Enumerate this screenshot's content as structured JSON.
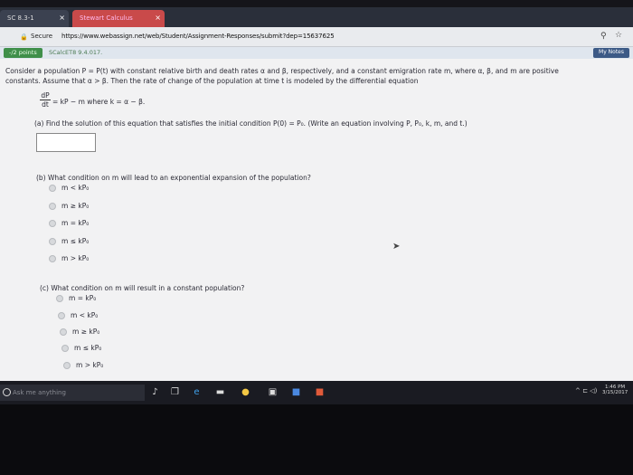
{
  "browser": {
    "tabs": [
      {
        "label": "SC 8.3-1"
      },
      {
        "label": "Stewart Calculus"
      }
    ],
    "secure_label": "Secure",
    "url": "https://www.webassign.net/web/Student/Assignment-Responses/submit?dep=15637625"
  },
  "assignment": {
    "points": "-/2 points",
    "score_info": "SCalcET8 9.4.017.",
    "my_notes": "My Notes"
  },
  "question": {
    "intro_line1": "Consider a population P = P(t) with constant relative birth and death rates α and β, respectively, and a constant emigration rate m, where α, β, and m are positive",
    "intro_line2": "constants. Assume that α > β. Then the rate of change of the population at time t is modeled by the differential equation",
    "eq_num": "dP",
    "eq_den": "dt",
    "eq_rest": "= kP − m   where  k = α − β.",
    "part_a": "(a) Find the solution of this equation that satisfies the initial condition  P(0) = P₀.  (Write an equation involving P, P₀, k, m, and t.)",
    "part_b": "(b) What condition on m will lead to an exponential expansion of the population?",
    "part_b_options": [
      "m < kP₀",
      "m ≥ kP₀",
      "m = kP₀",
      "m ≤ kP₀",
      "m > kP₀"
    ],
    "part_c": "(c) What condition on m will result in a constant population?",
    "part_c_options": [
      "m = kP₀",
      "m < kP₀",
      "m ≥ kP₀",
      "m ≤ kP₀",
      "m > kP₀"
    ]
  },
  "taskbar": {
    "search_placeholder": "Ask me anything",
    "time": "1:46 PM",
    "date": "3/15/2017"
  }
}
